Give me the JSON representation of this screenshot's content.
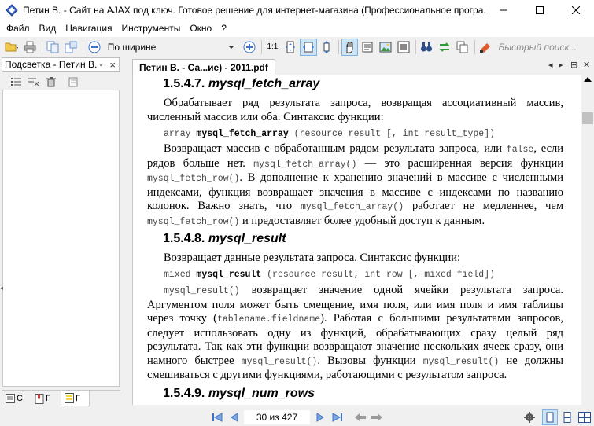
{
  "window": {
    "title": "Петин В. - Сайт на AJAX под ключ. Готовое решение для интернет-магазина (Профессиональное програ..."
  },
  "menu": [
    {
      "label": "Файл",
      "key": "file"
    },
    {
      "label": "Вид",
      "key": "view"
    },
    {
      "label": "Навигация",
      "key": "navigation"
    },
    {
      "label": "Инструменты",
      "key": "tools"
    },
    {
      "label": "Окно",
      "key": "window"
    },
    {
      "label": "?",
      "key": "help"
    }
  ],
  "toolbar": {
    "zoom_value": "По ширине",
    "actual_size_label": "1:1",
    "search_placeholder": "Быстрый поиск..."
  },
  "left_panel": {
    "title": "Подсветка - Петин В. -",
    "close_label": "×",
    "tabs": [
      "С",
      "Г",
      "Г"
    ]
  },
  "document_tab": {
    "label": "Петин В. - Са...ие) - 2011.pdf"
  },
  "page": {
    "h1": {
      "num": "1.5.4.7.",
      "name": "mysql_fetch_array"
    },
    "p1": "Обрабатывает ряд результата запроса, возвращая ассоциативный массив, численный массив или оба. Синтаксис функции:",
    "syn1": {
      "type": "array",
      "fn": "mysql_fetch_array",
      "args": "(resource result [, int result_type])"
    },
    "p2": {
      "t1": "Возвращает массив с обработанным рядом результата запроса, или",
      "c1": "false",
      "t2": ", если рядов больше нет.",
      "c2": "mysql_fetch_array()",
      "t3": "— это расширенная версия функции",
      "c3": "mysql_fetch_row()",
      "t4": ". В дополнение к хранению значений в массиве с численными индексами, функция возвращает значения в массиве с индексами по названию колонок. Важно знать, что",
      "c4": "mysql_fetch_array()",
      "t5": "работает не медленнее, чем",
      "c5": "mysql_fetch_row()",
      "t6": "и предоставляет более удобный доступ к данным."
    },
    "h2": {
      "num": "1.5.4.8.",
      "name": "mysql_result"
    },
    "p3": "Возвращает данные результата запроса. Синтаксис функции:",
    "syn2": {
      "type": "mixed",
      "fn": "mysql_result",
      "args": "(resource result, int row [, mixed field])"
    },
    "p4": {
      "c1": "mysql_result()",
      "t1": "возвращает значение одной ячейки результата запроса. Аргументом поля может быть смещение, имя поля, или имя поля и имя таблицы через точку (",
      "c2": "tablename.fieldname",
      "t2": "). Работая с большими результатами запросов, следует использовать одну из функций, обрабатывающих сразу целый ряд результата. Так как эти функции возвращают значение нескольких ячеек сразу, они намного быстрее",
      "c3": "mysql_result()",
      "t3": ". Вызовы функции",
      "c4": "mysql_result()",
      "t4": "не должны смешиваться с другими функциями, работающими с результатом запроса."
    },
    "h3": {
      "num": "1.5.4.9.",
      "name": "mysql_num_rows"
    }
  },
  "status": {
    "page_indicator": "30 из 427"
  },
  "colors": {
    "selection": "#cce4f7",
    "selection_border": "#7fb3dd",
    "chrome": "#f0f0f0"
  }
}
